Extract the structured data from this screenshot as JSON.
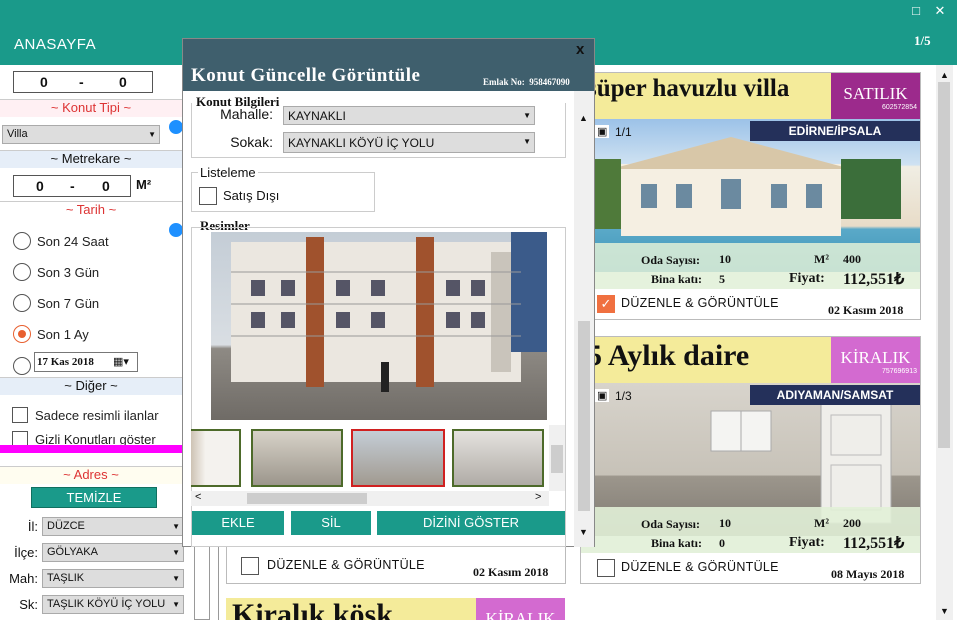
{
  "window": {
    "maximize_icon": "maximize-icon",
    "close_icon": "close-icon",
    "maximize_glyph": "□",
    "close_glyph": "✕"
  },
  "header": {
    "title": "ANASAYFA",
    "page": "1/5"
  },
  "sidebar": {
    "price_min": "0",
    "price_sep": "-",
    "price_max": "0",
    "konut_tipi_label": "~ Konut Tipi ~",
    "konut_tipi_value": "Villa",
    "metrekare_label": "~ Metrekare ~",
    "m2_min": "0",
    "m2_sep": "-",
    "m2_max": "0",
    "m2_unit": "M²",
    "tarih_label": "~ Tarih ~",
    "tarih_options": [
      "Son 24 Saat",
      "Son 3 Gün",
      "Son 7 Gün",
      "Son 1 Ay"
    ],
    "tarih_date": "17 Kas 2018",
    "diger_label": "~ Diğer ~",
    "diger_options": [
      "Sadece resimli ilanlar",
      "Gizli Konutları göster"
    ],
    "adres_label": "~ Adres ~",
    "temizle": "TEMİZLE",
    "adres_fields": [
      {
        "label": "İl:",
        "value": "DÜZCE"
      },
      {
        "label": "İlçe:",
        "value": "GÖLYAKA"
      },
      {
        "label": "Mah:",
        "value": "TAŞLIK"
      },
      {
        "label": "Sk:",
        "value": "TAŞLIK KÖYÜ İÇ YOLU"
      }
    ]
  },
  "cards": {
    "c1": {
      "title": "süper havuzlu villa",
      "badge": "SATILIK",
      "badge_no": "602572854",
      "photos": "1/1",
      "location": "EDİRNE/İPSALA",
      "oda_label": "Oda Sayısı:",
      "oda": "10",
      "m2_label": "M²",
      "m2": "400",
      "kat_label": "Bina katı:",
      "kat": "5",
      "fiyat_label": "Fiyat:",
      "fiyat": "112,551₺",
      "edit": "DÜZENLE & GÖRÜNTÜLE",
      "date": "02 Kasım 2018",
      "badge_color": "#9c2a8c"
    },
    "c2": {
      "title": "5 Aylık daire",
      "badge": "KİRALIK",
      "badge_no": "757696913",
      "photos": "1/3",
      "location": "ADIYAMAN/SAMSAT",
      "oda_label": "Oda Sayısı:",
      "oda": "10",
      "m2_label": "M²",
      "m2": "200",
      "kat_label": "Bina katı:",
      "kat": "0",
      "fiyat_label": "Fiyat:",
      "fiyat": "112,551₺",
      "edit": "DÜZENLE & GÖRÜNTÜLE",
      "date": "08 Mayıs 2018",
      "badge_color": "#d36ad0"
    },
    "c3": {
      "edit": "DÜZENLE & GÖRÜNTÜLE",
      "date": "02 Kasım 2018"
    },
    "c4": {
      "title": "Kiralık köşk",
      "badge": "KİRALIK"
    }
  },
  "dialog": {
    "title": "Konut Güncelle  Görüntüle",
    "close": "x",
    "emlak_label": "Emlak No:",
    "emlak_no": "958467090",
    "konut_bilgileri": "Konut Bilgileri",
    "mahalle_label": "Mahalle:",
    "mahalle_value": "KAYNAKLI",
    "sokak_label": "Sokak:",
    "sokak_value": "KAYNAKLI KÖYÜ İÇ YOLU",
    "listeleme": "Listeleme",
    "satis_disi": "Satış Dışı",
    "resimler": "Resimler",
    "buttons": {
      "ekle": "EKLE",
      "sil": "SİL",
      "dizin": "DİZİNİ GÖSTER"
    }
  }
}
